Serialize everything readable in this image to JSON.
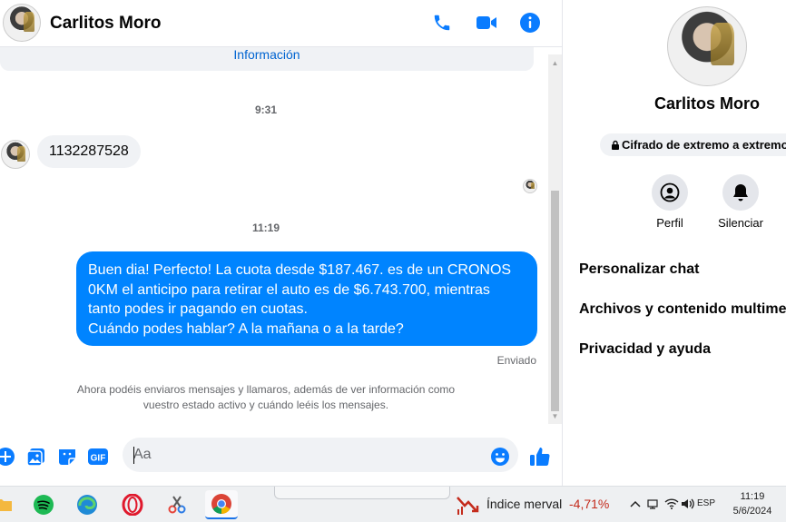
{
  "header": {
    "contact_name": "Carlitos Moro",
    "icons": [
      "phone-icon",
      "video-camera-icon",
      "info-icon"
    ]
  },
  "colors": {
    "accent": "#0084ff",
    "bubble_in": "#f0f2f5",
    "muted": "#65676b",
    "negative": "#c42b1c"
  },
  "chat": {
    "info_link": "Información",
    "timestamp_1": "9:31",
    "incoming_message": "1132287528",
    "timestamp_2": "11:19",
    "outgoing_lines": [
      "Buen dia! Perfecto! La cuota desde $187.467. es de un CRONOS",
      "0KM el anticipo para retirar el auto es de $6.743.700, mientras",
      "tanto podes ir pagando en cuotas.",
      "Cuándo podes hablar? A la mañana o a la tarde?"
    ],
    "sent_status": "Enviado",
    "notice_lines": [
      "Ahora podéis enviaros mensajes y llamaros, además de ver información como",
      "vuestro estado activo y cuándo leéis los mensajes."
    ]
  },
  "composer": {
    "placeholder": "Aa",
    "icons": [
      "plus-icon",
      "photo-icon",
      "sticker-icon",
      "gif-icon",
      "emoji-icon",
      "thumbs-up-icon"
    ],
    "gif_label": "GIF"
  },
  "panel": {
    "contact_name": "Carlitos Moro",
    "encryption_label": "Cifrado de extremo a extremo",
    "actions": [
      {
        "label": "Perfil",
        "icon": "profile-icon"
      },
      {
        "label": "Silenciar",
        "icon": "bell-icon"
      }
    ],
    "menu": [
      "Personalizar chat",
      "Archivos y contenido multimedia",
      "Privacidad y ayuda"
    ]
  },
  "taskbar": {
    "market_name": "Índice merval",
    "market_change": "-4,71%",
    "language": "ESP",
    "time": "11:19",
    "date": "5/6/2024"
  }
}
